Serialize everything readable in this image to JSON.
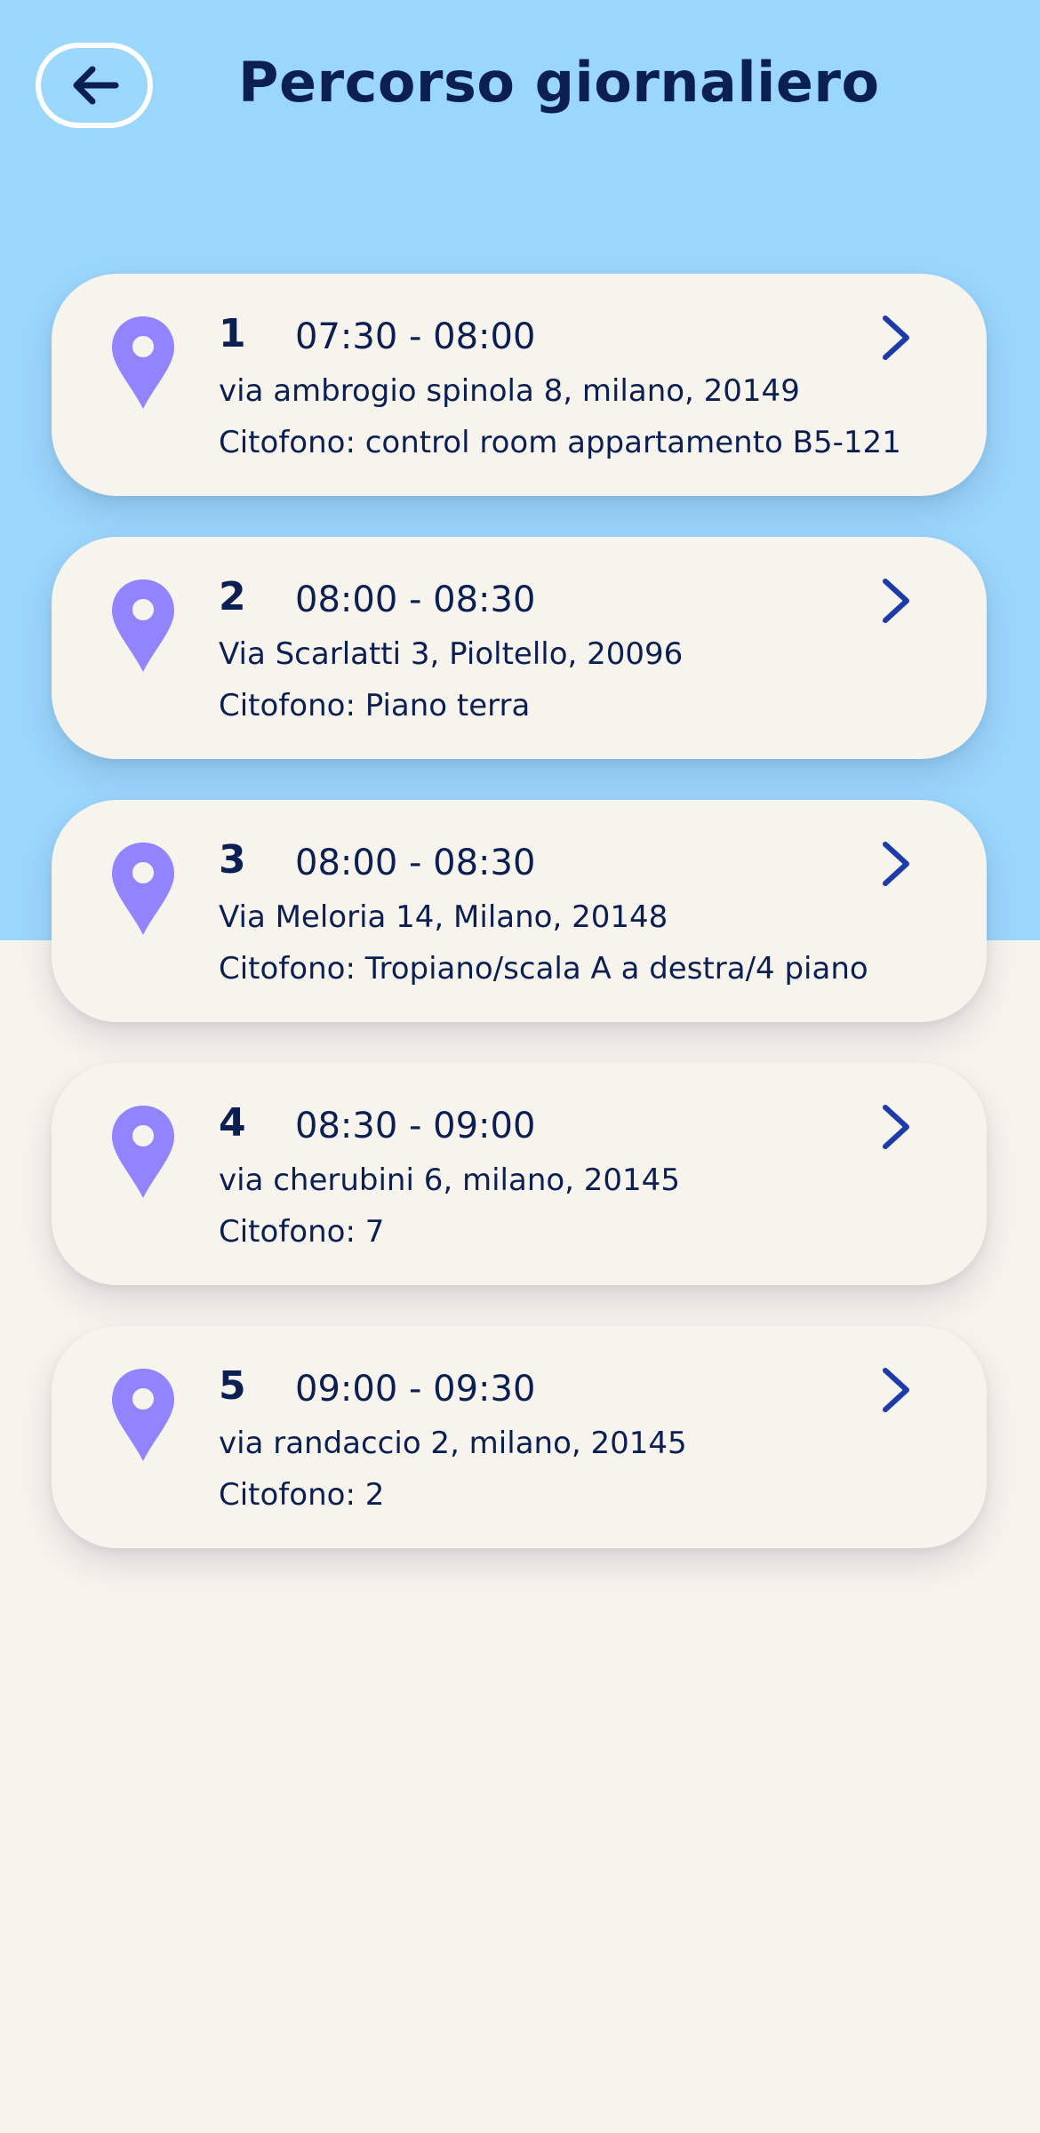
{
  "header": {
    "title": "Percorso giornaliero",
    "back_icon": "arrow-left-icon"
  },
  "colors": {
    "header_background": "#9bd6fd",
    "page_background": "#f7f4ee",
    "pin": "#9283ff",
    "chevron": "#1c3aa9",
    "text": "#0c1f52"
  },
  "stops": [
    {
      "number": "1",
      "time": "07:30 - 08:00",
      "address": "via ambrogio spinola 8, milano, 20149",
      "intercom": "Citofono: control room appartamento B5-121"
    },
    {
      "number": "2",
      "time": "08:00 - 08:30",
      "address": "Via Scarlatti 3, Pioltello, 20096",
      "intercom": "Citofono: Piano terra"
    },
    {
      "number": "3",
      "time": "08:00 - 08:30",
      "address": "Via Meloria 14, Milano, 20148",
      "intercom": "Citofono: Tropiano/scala A a destra/4 piano"
    },
    {
      "number": "4",
      "time": "08:30 - 09:00",
      "address": "via cherubini 6, milano, 20145",
      "intercom": "Citofono: 7"
    },
    {
      "number": "5",
      "time": "09:00 - 09:30",
      "address": "via randaccio 2, milano, 20145",
      "intercom": "Citofono: 2"
    }
  ]
}
